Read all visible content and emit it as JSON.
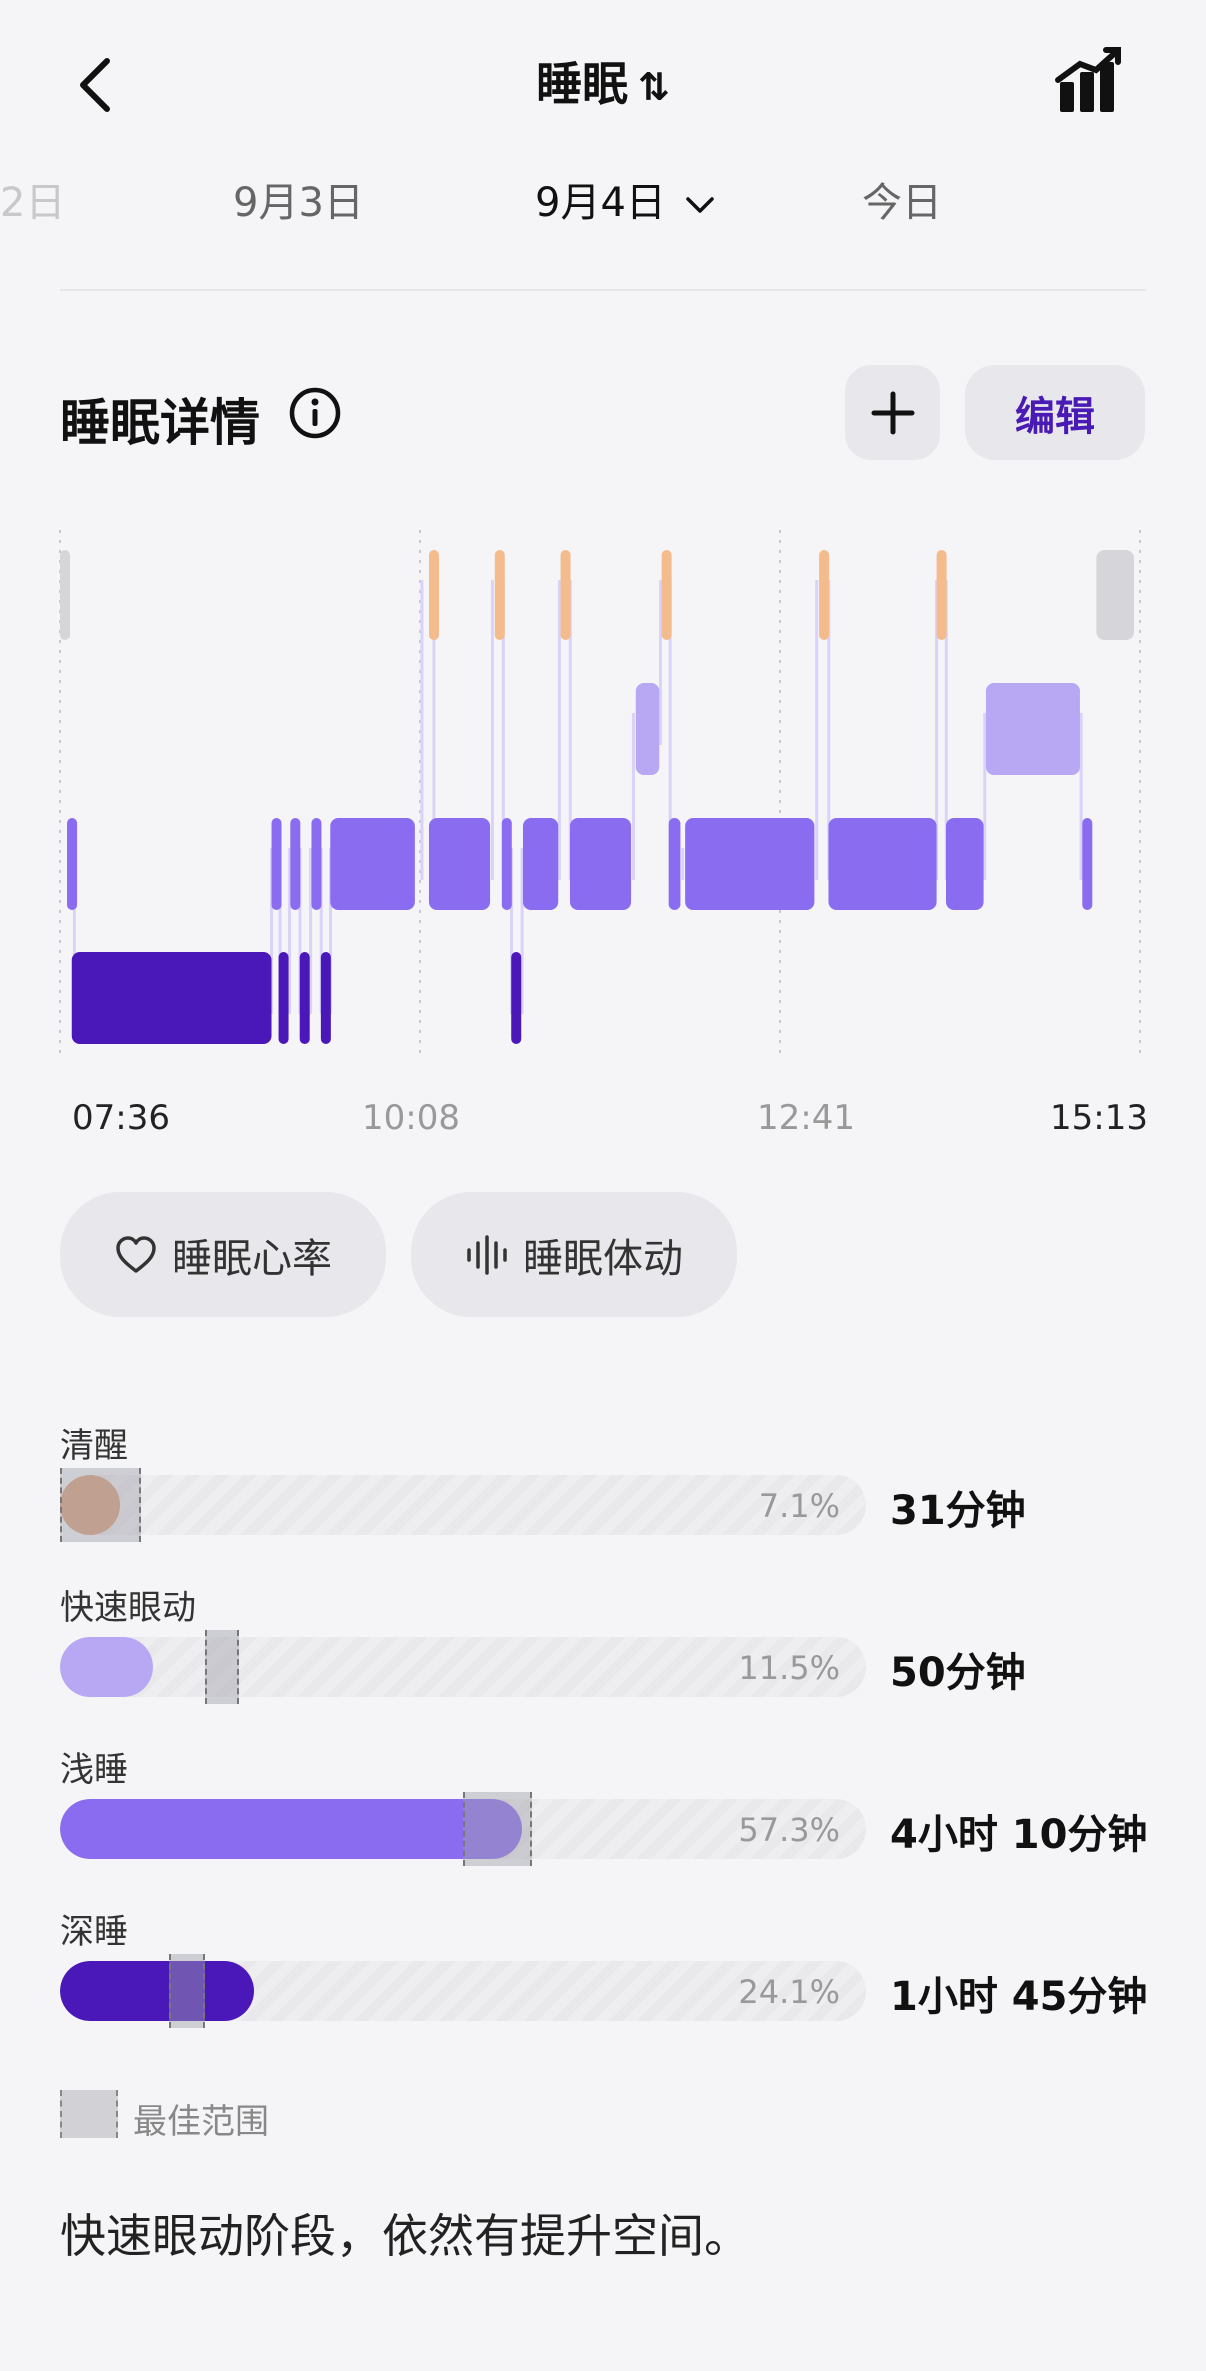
{
  "header": {
    "title": "睡眠",
    "sort_glyph": "⇅"
  },
  "dates": {
    "partial_prev": "2日",
    "prev": "9月3日",
    "current": "9月4日",
    "next": "今日"
  },
  "section": {
    "title": "睡眠详情",
    "add_label": "+",
    "edit_label": "编辑"
  },
  "chart_data": {
    "type": "hypnogram",
    "time_labels": [
      "07:36",
      "10:08",
      "12:41",
      "15:13"
    ],
    "stages": [
      "清醒",
      "快速眼动",
      "浅睡",
      "深睡"
    ],
    "colors": {
      "awake": "#f4bb8d",
      "rem": "#b8a8f4",
      "light": "#8a6cf0",
      "deep": "#4a18b8",
      "offbed": "#d6d6da"
    },
    "segments": [
      {
        "stage": "offbed",
        "start": "07:36",
        "end": "07:40"
      },
      {
        "stage": "light",
        "start": "07:39",
        "end": "07:41"
      },
      {
        "stage": "deep",
        "start": "07:41",
        "end": "09:06"
      },
      {
        "stage": "light",
        "start": "09:06",
        "end": "09:09"
      },
      {
        "stage": "deep",
        "start": "09:09",
        "end": "09:13"
      },
      {
        "stage": "light",
        "start": "09:14",
        "end": "09:18"
      },
      {
        "stage": "deep",
        "start": "09:18",
        "end": "09:22"
      },
      {
        "stage": "light",
        "start": "09:23",
        "end": "09:27"
      },
      {
        "stage": "deep",
        "start": "09:27",
        "end": "09:31"
      },
      {
        "stage": "light",
        "start": "09:31",
        "end": "10:07"
      },
      {
        "stage": "awake",
        "start": "10:13",
        "end": "10:16"
      },
      {
        "stage": "light",
        "start": "10:13",
        "end": "10:39"
      },
      {
        "stage": "awake",
        "start": "10:41",
        "end": "10:44"
      },
      {
        "stage": "light",
        "start": "10:44",
        "end": "10:48"
      },
      {
        "stage": "deep",
        "start": "10:48",
        "end": "10:52"
      },
      {
        "stage": "light",
        "start": "10:53",
        "end": "11:08"
      },
      {
        "stage": "awake",
        "start": "11:09",
        "end": "11:12"
      },
      {
        "stage": "light",
        "start": "11:13",
        "end": "11:39"
      },
      {
        "stage": "rem",
        "start": "11:41",
        "end": "11:51"
      },
      {
        "stage": "awake",
        "start": "11:52",
        "end": "11:55"
      },
      {
        "stage": "light",
        "start": "11:55",
        "end": "12:00"
      },
      {
        "stage": "light",
        "start": "12:02",
        "end": "12:57"
      },
      {
        "stage": "awake",
        "start": "12:59",
        "end": "13:03"
      },
      {
        "stage": "light",
        "start": "13:03",
        "end": "13:49"
      },
      {
        "stage": "awake",
        "start": "13:49",
        "end": "13:53"
      },
      {
        "stage": "light",
        "start": "13:53",
        "end": "14:09"
      },
      {
        "stage": "rem",
        "start": "14:10",
        "end": "14:50"
      },
      {
        "stage": "light",
        "start": "14:51",
        "end": "14:55"
      },
      {
        "stage": "offbed",
        "start": "14:57",
        "end": "15:13"
      }
    ]
  },
  "buttons": {
    "heart_rate": "睡眠心率",
    "movement": "睡眠体动"
  },
  "stage_stats": [
    {
      "label": "清醒",
      "percent": "7.1%",
      "fraction": 0.071,
      "duration": "31分钟",
      "color": "#d9a07d",
      "best_from": 0.0,
      "best_to": 0.1
    },
    {
      "label": "快速眼动",
      "percent": "11.5%",
      "fraction": 0.115,
      "duration": "50分钟",
      "color": "#b8a8f4",
      "best_from": 0.18,
      "best_to": 0.22
    },
    {
      "label": "浅睡",
      "percent": "57.3%",
      "fraction": 0.573,
      "duration": "4小时 10分钟",
      "color": "#8a6cf0",
      "best_from": 0.5,
      "best_to": 0.585
    },
    {
      "label": "深睡",
      "percent": "24.1%",
      "fraction": 0.241,
      "duration": "1小时 45分钟",
      "color": "#4a18b8",
      "best_from": 0.135,
      "best_to": 0.18
    }
  ],
  "legend": {
    "best_range": "最佳范围"
  },
  "summary": "快速眼动阶段，依然有提升空间。"
}
